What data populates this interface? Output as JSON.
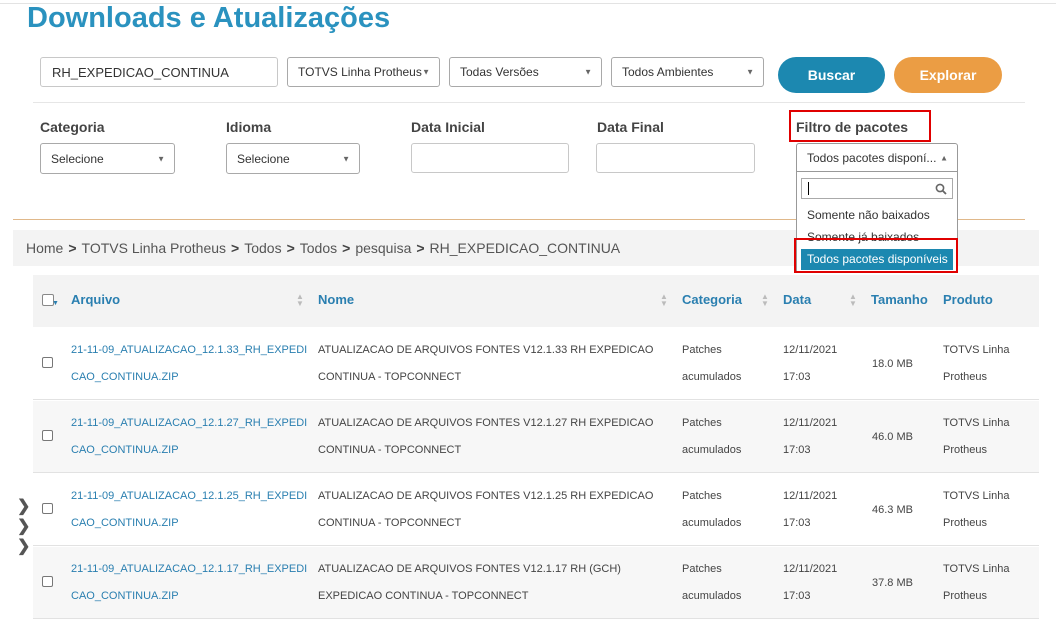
{
  "page_title": "Downloads e Atualizações",
  "search": {
    "value": "RH_EXPEDICAO_CONTINUA"
  },
  "selects": {
    "produto": "TOTVS Linha Protheus",
    "versoes": "Todas Versões",
    "ambientes": "Todos Ambientes"
  },
  "buttons": {
    "buscar": "Buscar",
    "explorar": "Explorar"
  },
  "filters": {
    "categoria_label": "Categoria",
    "categoria_value": "Selecione",
    "idioma_label": "Idioma",
    "idioma_value": "Selecione",
    "data_inicial_label": "Data Inicial",
    "data_final_label": "Data Final",
    "pacotes_label": "Filtro de pacotes",
    "pacotes_value": "Todos pacotes disponí..."
  },
  "dropdown": {
    "options": [
      "Somente não baixados",
      "Somente já baixados",
      "Todos pacotes disponíveis"
    ],
    "selected_index": 2
  },
  "breadcrumb": [
    "Home",
    "TOTVS Linha Protheus",
    "Todos",
    "Todos",
    "pesquisa",
    "RH_EXPEDICAO_CONTINUA"
  ],
  "table": {
    "columns": [
      "Arquivo",
      "Nome",
      "Categoria",
      "Data",
      "Tamanho",
      "Produto"
    ],
    "rows": [
      {
        "arquivo": [
          "21-11-09_ATUALIZACAO_12.1.33_RH_EXPEDI",
          "CAO_CONTINUA.ZIP"
        ],
        "nome": [
          "ATUALIZACAO DE ARQUIVOS FONTES V12.1.33 RH EXPEDICAO",
          "CONTINUA - TOPCONNECT"
        ],
        "categoria": [
          "Patches",
          "acumulados"
        ],
        "data": [
          "12/11/2021",
          "17:03"
        ],
        "tamanho": "18.0 MB",
        "produto": [
          "TOTVS Linha",
          "Protheus"
        ]
      },
      {
        "arquivo": [
          "21-11-09_ATUALIZACAO_12.1.27_RH_EXPEDI",
          "CAO_CONTINUA.ZIP"
        ],
        "nome": [
          "ATUALIZACAO DE ARQUIVOS FONTES V12.1.27 RH EXPEDICAO",
          "CONTINUA - TOPCONNECT"
        ],
        "categoria": [
          "Patches",
          "acumulados"
        ],
        "data": [
          "12/11/2021",
          "17:03"
        ],
        "tamanho": "46.0 MB",
        "produto": [
          "TOTVS Linha",
          "Protheus"
        ]
      },
      {
        "arquivo": [
          "21-11-09_ATUALIZACAO_12.1.25_RH_EXPEDI",
          "CAO_CONTINUA.ZIP"
        ],
        "nome": [
          "ATUALIZACAO DE ARQUIVOS FONTES V12.1.25 RH EXPEDICAO",
          "CONTINUA - TOPCONNECT"
        ],
        "categoria": [
          "Patches",
          "acumulados"
        ],
        "data": [
          "12/11/2021",
          "17:03"
        ],
        "tamanho": "46.3 MB",
        "produto": [
          "TOTVS Linha",
          "Protheus"
        ]
      },
      {
        "arquivo": [
          "21-11-09_ATUALIZACAO_12.1.17_RH_EXPEDI",
          "CAO_CONTINUA.ZIP"
        ],
        "nome": [
          "ATUALIZACAO DE ARQUIVOS FONTES V12.1.17 RH (GCH)",
          "EXPEDICAO CONTINUA - TOPCONNECT"
        ],
        "categoria": [
          "Patches",
          "acumulados"
        ],
        "data": [
          "12/11/2021",
          "17:03"
        ],
        "tamanho": "37.8 MB",
        "produto": [
          "TOTVS Linha",
          "Protheus"
        ]
      }
    ]
  },
  "colors": {
    "accent": "#2a92bf",
    "buscar": "#1c88b0",
    "explorar": "#eb9d44",
    "highlight": "#e00000"
  },
  "icons": {
    "search": "search-icon",
    "chevron": "chevron-right-icon",
    "caret": "caret-down-icon"
  }
}
